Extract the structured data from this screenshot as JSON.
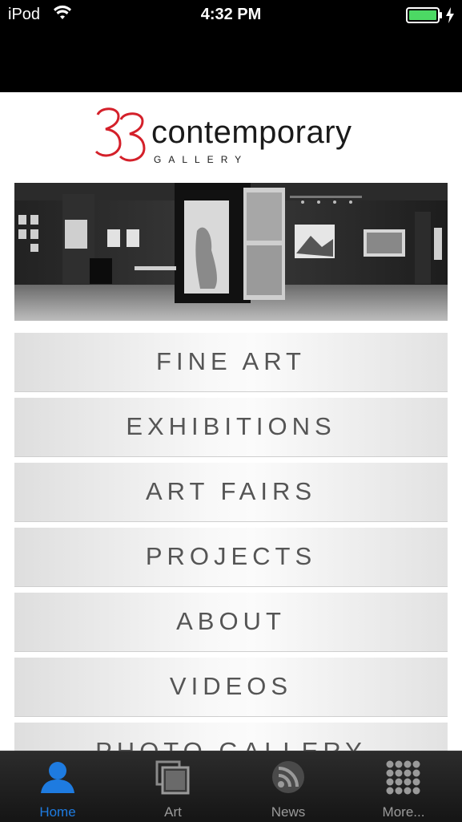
{
  "status_bar": {
    "carrier": "iPod",
    "time": "4:32 PM",
    "battery_color": "#4cd964"
  },
  "logo": {
    "mark": "33",
    "wordmark": "contemporary",
    "subtitle": "GALLERY",
    "mark_color": "#d4202a"
  },
  "hero": {
    "icon": "gallery-panorama-photo"
  },
  "menu": {
    "items": [
      {
        "label": "FINE ART"
      },
      {
        "label": "EXHIBITIONS"
      },
      {
        "label": "ART FAIRS"
      },
      {
        "label": "PROJECTS"
      },
      {
        "label": "ABOUT"
      },
      {
        "label": "VIDEOS"
      },
      {
        "label": "PHOTO GALLERY"
      }
    ]
  },
  "tabbar": {
    "active_color": "#1e7be0",
    "tabs": [
      {
        "label": "Home",
        "icon": "person-icon",
        "active": true
      },
      {
        "label": "Art",
        "icon": "stacked-frames-icon",
        "active": false
      },
      {
        "label": "News",
        "icon": "rss-icon",
        "active": false
      },
      {
        "label": "More...",
        "icon": "grid-dots-icon",
        "active": false
      }
    ]
  }
}
